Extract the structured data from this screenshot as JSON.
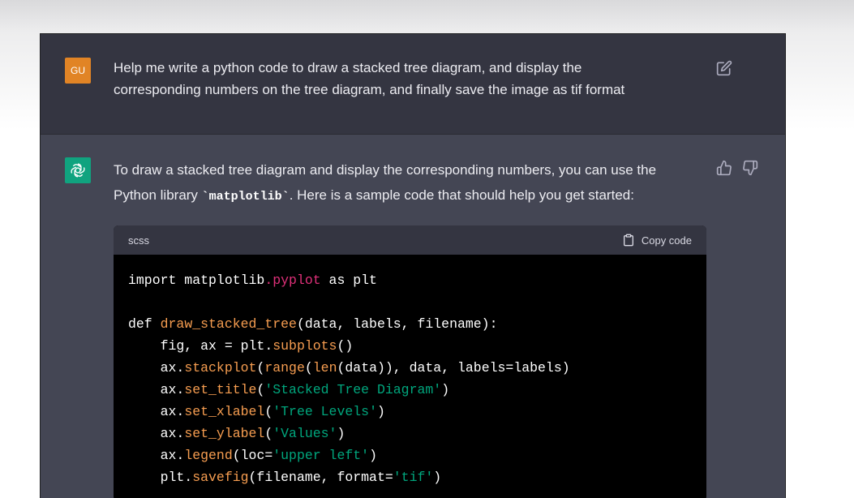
{
  "user": {
    "avatar_label": "GU",
    "message_line1": "Help me write a python code to draw a stacked tree diagram, and display the",
    "message_line2": "corresponding numbers on the tree diagram, and finally save the image as tif format"
  },
  "assistant": {
    "intro_part1": "To draw a stacked tree diagram and display the corresponding numbers, you can use the",
    "intro_part2": "Python library ",
    "inline_code": "`matplotlib`",
    "intro_part3": ". Here is a sample code that should help you get started:",
    "code_language": "scss",
    "copy_label": "Copy code",
    "code_lines": [
      [
        [
          "t",
          "import matplotlib"
        ],
        [
          "p",
          ".pyplot"
        ],
        [
          "t",
          " as plt"
        ]
      ],
      [],
      [
        [
          "t",
          "def "
        ],
        [
          "f",
          "draw_stacked_tree"
        ],
        [
          "t",
          "(data, labels, filename):"
        ]
      ],
      [
        [
          "t",
          "    fig, ax = plt."
        ],
        [
          "f",
          "subplots"
        ],
        [
          "t",
          "()"
        ]
      ],
      [
        [
          "t",
          "    ax."
        ],
        [
          "f",
          "stackplot"
        ],
        [
          "t",
          "("
        ],
        [
          "f",
          "range"
        ],
        [
          "t",
          "("
        ],
        [
          "f",
          "len"
        ],
        [
          "t",
          "(data)), data, labels=labels)"
        ]
      ],
      [
        [
          "t",
          "    ax."
        ],
        [
          "f",
          "set_title"
        ],
        [
          "t",
          "("
        ],
        [
          "s",
          "'Stacked Tree Diagram'"
        ],
        [
          "t",
          ")"
        ]
      ],
      [
        [
          "t",
          "    ax."
        ],
        [
          "f",
          "set_xlabel"
        ],
        [
          "t",
          "("
        ],
        [
          "s",
          "'Tree Levels'"
        ],
        [
          "t",
          ")"
        ]
      ],
      [
        [
          "t",
          "    ax."
        ],
        [
          "f",
          "set_ylabel"
        ],
        [
          "t",
          "("
        ],
        [
          "s",
          "'Values'"
        ],
        [
          "t",
          ")"
        ]
      ],
      [
        [
          "t",
          "    ax."
        ],
        [
          "f",
          "legend"
        ],
        [
          "t",
          "(loc="
        ],
        [
          "s",
          "'upper left'"
        ],
        [
          "t",
          ")"
        ]
      ],
      [
        [
          "t",
          "    plt."
        ],
        [
          "f",
          "savefig"
        ],
        [
          "t",
          "(filename, format="
        ],
        [
          "s",
          "'tif'"
        ],
        [
          "t",
          ")"
        ]
      ]
    ]
  },
  "icons": {
    "edit": "edit-icon",
    "thumbs_up": "thumbs-up-icon",
    "thumbs_down": "thumbs-down-icon",
    "copy": "clipboard-icon",
    "bot": "openai-logo-icon"
  },
  "colors": {
    "user_avatar": "#e18425",
    "bot_avatar": "#10a37f",
    "code_function": "#f69d50",
    "code_property": "#df3079",
    "code_string": "#00a67d"
  }
}
